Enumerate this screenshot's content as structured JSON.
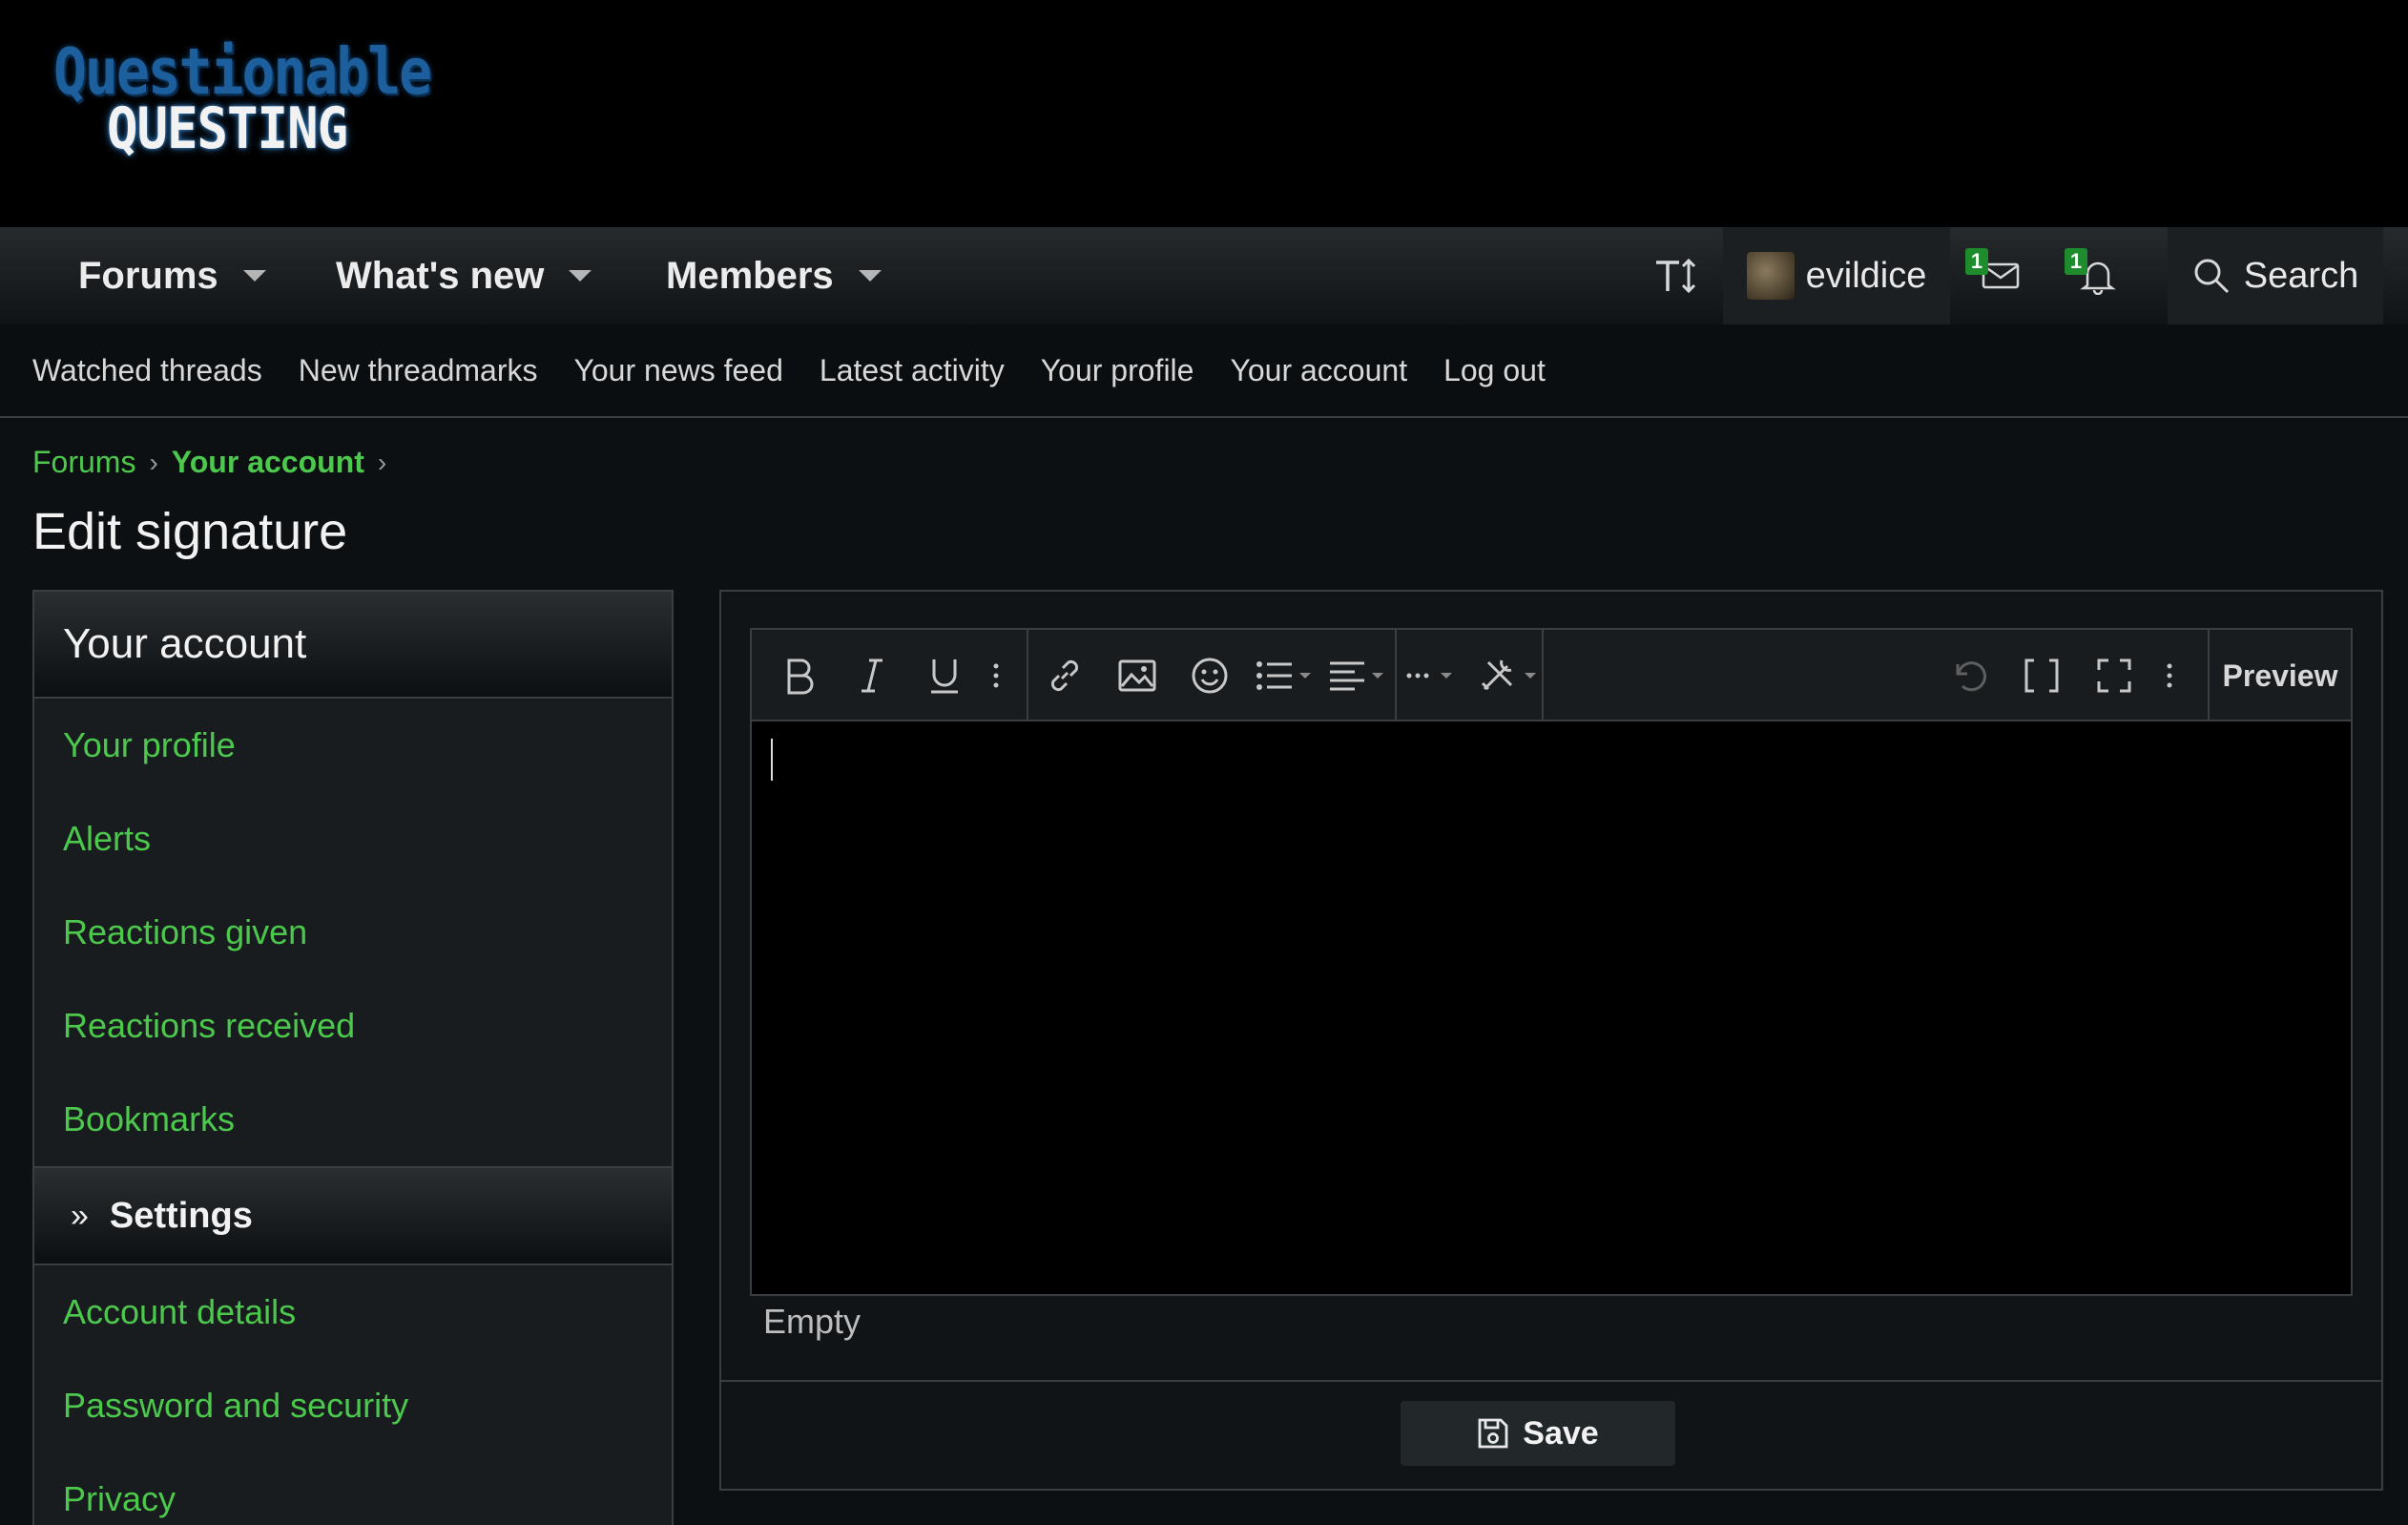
{
  "logo": {
    "line1": "Questionable",
    "line2": "QUESTING"
  },
  "nav": {
    "tabs": [
      "Forums",
      "What's new",
      "Members"
    ],
    "username": "evildice",
    "conversations_badge": "1",
    "alerts_badge": "1",
    "search_label": "Search"
  },
  "subnav": [
    "Watched threads",
    "New threadmarks",
    "Your news feed",
    "Latest activity",
    "Your profile",
    "Your account",
    "Log out"
  ],
  "breadcrumb": {
    "root": "Forums",
    "current": "Your account"
  },
  "page_title": "Edit signature",
  "sidebar": {
    "heading": "Your account",
    "items": [
      "Your profile",
      "Alerts",
      "Reactions given",
      "Reactions received",
      "Bookmarks"
    ],
    "section_label": "Settings",
    "settings_items": [
      "Account details",
      "Password and security",
      "Privacy"
    ]
  },
  "editor": {
    "preview_label": "Preview",
    "empty_hint": "Empty",
    "save_label": "Save"
  },
  "colors": {
    "accent_green": "#4cc94c",
    "badge_green": "#1e8b2c",
    "background": "#0d1012"
  }
}
